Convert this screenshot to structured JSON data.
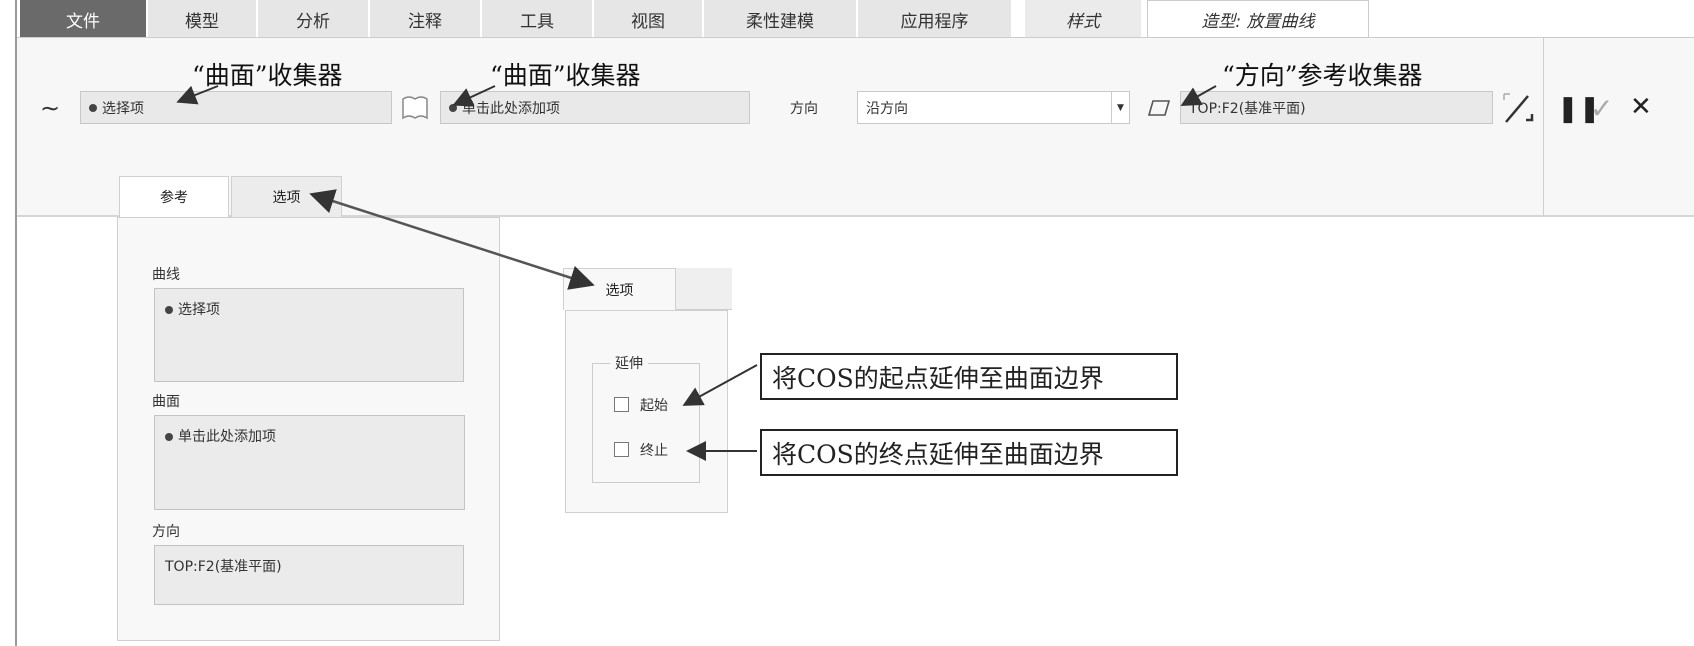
{
  "tabs": [
    "文件",
    "模型",
    "分析",
    "注释",
    "工具",
    "视图",
    "柔性建模",
    "应用程序",
    "样式",
    "造型: 放置曲线"
  ],
  "ribbon": {
    "curve_collector": "选择项",
    "surface_collector": "单击此处添加项",
    "direction_label": "方向",
    "direction_select": "沿方向",
    "direction_ref": "TOP:F2(基准平面)"
  },
  "annotations": {
    "curve_collector": "“曲面”收集器",
    "surface_collector": "“曲面”收集器",
    "direction_collector": "“方向”参考收集器",
    "start_note": "将COS的起点延伸至曲面边界",
    "end_note": "将COS的终点延伸至曲面边界"
  },
  "bottom_tabs": [
    "参考",
    "选项"
  ],
  "ref_panel": {
    "curve_label": "曲线",
    "curve_value": "选择项",
    "surface_label": "曲面",
    "surface_value": "单击此处添加项",
    "direction_label": "方向",
    "direction_value": "TOP:F2(基准平面)"
  },
  "options_panel": {
    "tab": "选项",
    "group": "延伸",
    "start": {
      "label": "起始",
      "checked": false
    },
    "end": {
      "label": "终止",
      "checked": false
    }
  }
}
